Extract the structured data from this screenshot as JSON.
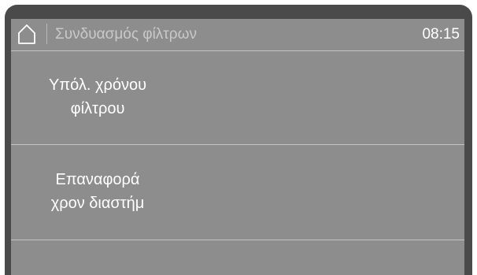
{
  "header": {
    "title": "Συνδυασμός φίλτρων",
    "time": "08:15",
    "home_icon": "home-icon"
  },
  "menu": {
    "items": [
      {
        "line1": "Υπόλ. χρόνου",
        "line2": "φίλτρου"
      },
      {
        "line1": "Επαναφορά",
        "line2": "χρον διαστήμ"
      }
    ]
  },
  "colors": {
    "bezel": "#4a4a4a",
    "screen": "#8d8d8d",
    "divider": "#c4c4c4",
    "text": "#ffffff",
    "title_text": "#c9c9c9"
  }
}
